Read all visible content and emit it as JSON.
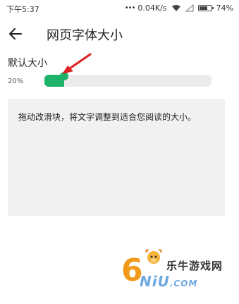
{
  "status_bar": {
    "time": "下午5:37",
    "net_speed": "0.04K/s",
    "battery_percent": "74%",
    "battery_level": 0.74
  },
  "app_bar": {
    "back_icon": "arrow-left-icon",
    "title": "网页字体大小"
  },
  "font_size": {
    "label": "默认大小",
    "percent_label": "20%",
    "slider_value": 0.12,
    "accent_color": "#1fb36a"
  },
  "preview": {
    "text": "拖动改滑块，将文字调整到适合您阅读的大小。"
  },
  "watermark": {
    "digit": "6",
    "chinese": "乐牛游戏网",
    "latin": "NiU",
    "domain_suffix": ".COM"
  }
}
